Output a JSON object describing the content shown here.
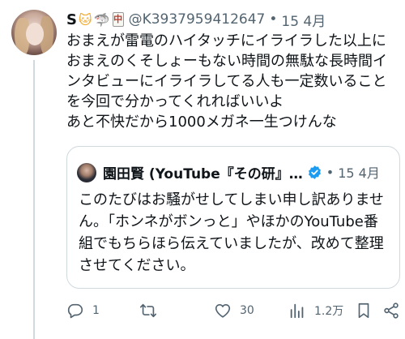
{
  "tweet": {
    "author_name": "S",
    "emojis": [
      "🐱",
      "🦈",
      "中"
    ],
    "handle": "@K3937959412647",
    "separator": "•",
    "date": "15 4月",
    "lines": [
      "おまえが雷電のハイタッチにイライラした以上に",
      "おまえのくそしょーもない時間の無駄な長時間イ",
      "ンタビューにイライラしてる人も一定数いること",
      "を今回で分かってくれればいいよ",
      "あと不快だから1000メガネ一生つけんな"
    ]
  },
  "quote": {
    "author_name": "園田賢 (YouTube『その研』…",
    "separator": "•",
    "date": "15 4月",
    "lines": [
      "このたびはお騒がせしてしまい申し訳ありませ",
      "ん。「ホンネがボンっと」やほかのYouTube番",
      "組でもちらほら伝えていましたが、改めて整理",
      "させてください。"
    ]
  },
  "actions": {
    "reply_count": "1",
    "retweet_count": "",
    "like_count": "30",
    "view_count": "1.2万"
  },
  "colors": {
    "text": "#0f1419",
    "muted": "#536471",
    "border": "#cfd9de",
    "verified": "#1d9bf0"
  }
}
